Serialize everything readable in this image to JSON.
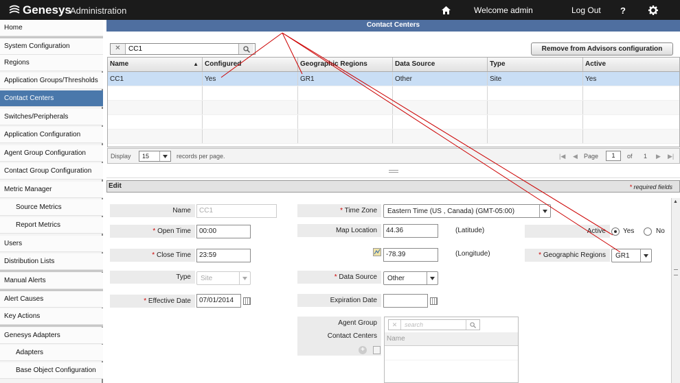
{
  "header": {
    "brand": "Genesys",
    "app_title": "Administration",
    "welcome": "Welcome  admin",
    "logout": "Log Out",
    "help": "?"
  },
  "sidebar": {
    "items": [
      {
        "label": "Home"
      },
      {
        "label": "System Configuration"
      },
      {
        "label": "Regions"
      },
      {
        "label": "Application Groups/Thresholds"
      },
      {
        "label": "Contact Centers",
        "active": true
      },
      {
        "label": "Switches/Peripherals"
      },
      {
        "label": "Application Configuration"
      },
      {
        "label": "Agent Group Configuration"
      },
      {
        "label": "Contact Group Configuration"
      },
      {
        "label": "Metric Manager"
      },
      {
        "label": "Source Metrics"
      },
      {
        "label": "Report Metrics"
      },
      {
        "label": "Users"
      },
      {
        "label": "Distribution Lists"
      },
      {
        "label": "Manual Alerts"
      },
      {
        "label": "Alert Causes"
      },
      {
        "label": "Key Actions"
      },
      {
        "label": "Genesys Adapters"
      },
      {
        "label": "Adapters"
      },
      {
        "label": "Base Object Configuration"
      }
    ]
  },
  "contact_centers": {
    "panel_title": "Contact Centers",
    "search_value": "CC1",
    "remove_button": "Remove from Advisors configuration",
    "columns": [
      "Name",
      "Configured",
      "Geographic Regions",
      "Data Source",
      "Type",
      "Active"
    ],
    "rows": [
      [
        "CC1",
        "Yes",
        "GR1",
        "Other",
        "Site",
        "Yes"
      ]
    ],
    "pager": {
      "display_label": "Display",
      "page_size": "15",
      "records_label": "records per page.",
      "page_label": "Page",
      "current_page": "1",
      "of_label": "of",
      "total_pages": "1"
    }
  },
  "edit": {
    "title": "Edit",
    "required_note": "required fields",
    "fields": {
      "name_label": "Name",
      "name_value": "CC1",
      "open_time_label": "Open Time",
      "open_time_value": "00:00",
      "close_time_label": "Close Time",
      "close_time_value": "23:59",
      "type_label": "Type",
      "type_value": "Site",
      "effective_date_label": "Effective Date",
      "effective_date_value": "07/01/2014",
      "time_zone_label": "Time Zone",
      "time_zone_value": "Eastern Time (US , Canada) (GMT-05:00)",
      "map_location_label": "Map Location",
      "latitude_value": "44.36",
      "latitude_label": "(Latitude)",
      "longitude_value": "-78.39",
      "longitude_label": "(Longitude)",
      "data_source_label": "Data Source",
      "data_source_value": "Other",
      "expiration_date_label": "Expiration Date",
      "expiration_date_value": "",
      "active_label": "Active",
      "active_yes": "Yes",
      "active_no": "No",
      "geo_regions_label": "Geographic Regions",
      "geo_regions_value": "GR1",
      "agent_group_label": "Agent Group",
      "contact_centers_label": "Contact Centers",
      "ag_search_placeholder": "search",
      "ag_name_header": "Name"
    }
  },
  "colors": {
    "topbar": "#1b1b1b",
    "header_blue": "#4f6fa0",
    "active_nav": "#4a78ab",
    "selected_row": "#c9def5",
    "callout_line": "#cc0000"
  }
}
